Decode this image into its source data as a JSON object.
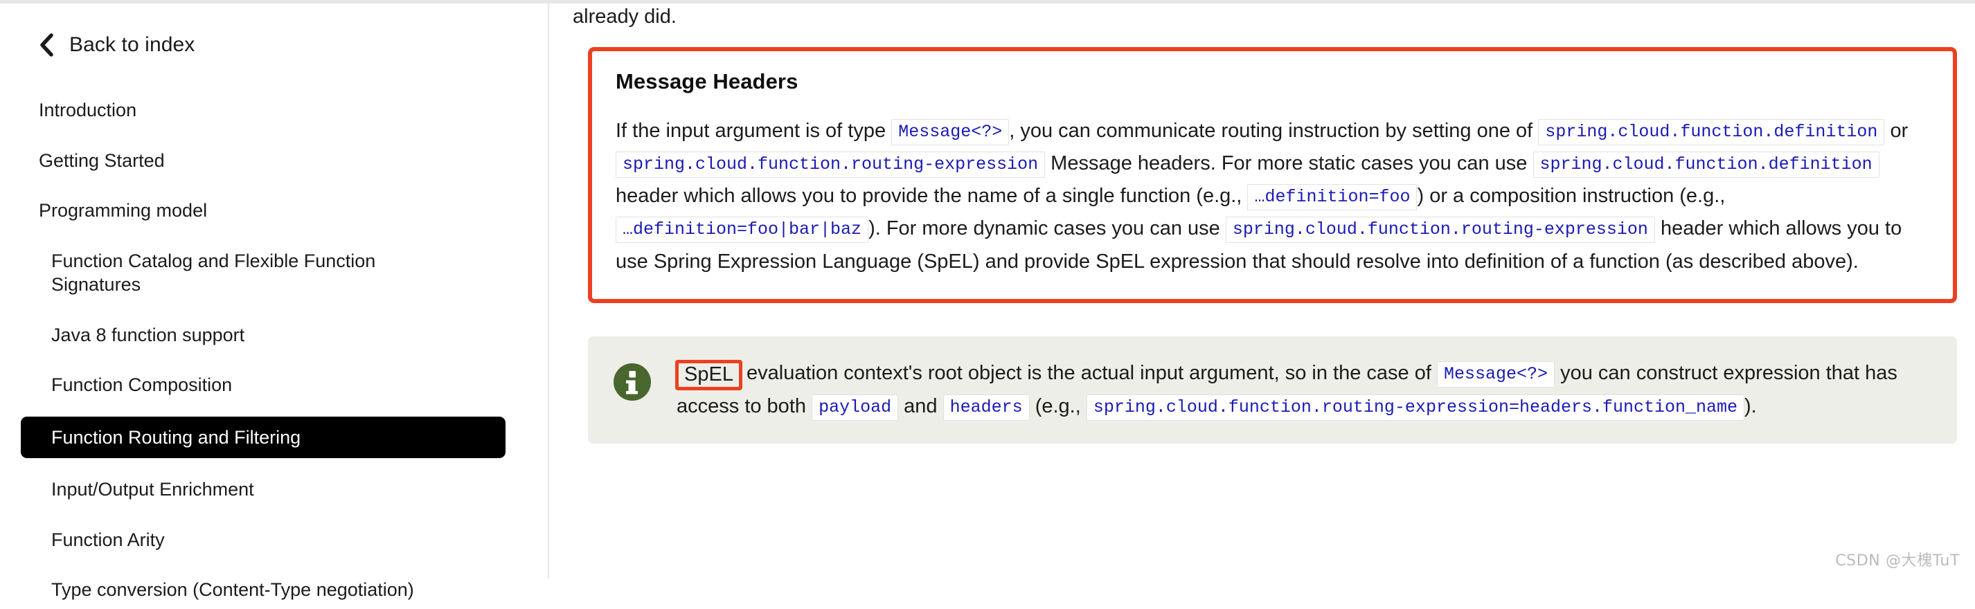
{
  "sidebar": {
    "back_label": "Back to index",
    "back_icon": "chevron-left-icon",
    "items": [
      {
        "label": "Introduction",
        "level": 1,
        "active": false
      },
      {
        "label": "Getting Started",
        "level": 1,
        "active": false
      },
      {
        "label": "Programming model",
        "level": 1,
        "active": false
      },
      {
        "label": "Function Catalog and Flexible Function Signatures",
        "level": 2,
        "active": false
      },
      {
        "label": "Java 8 function support",
        "level": 2,
        "active": false
      },
      {
        "label": "Function Composition",
        "level": 2,
        "active": false
      },
      {
        "label": "Function Routing and Filtering",
        "level": 2,
        "active": true
      },
      {
        "label": "Input/Output Enrichment",
        "level": 2,
        "active": false
      },
      {
        "label": "Function Arity",
        "level": 2,
        "active": false
      },
      {
        "label": "Type conversion (Content-Type negotiation)",
        "level": 2,
        "active": false
      }
    ]
  },
  "main": {
    "lead_text": "already did.",
    "callout": {
      "heading": "Message Headers",
      "border_color": "#ec4022",
      "paragraph": {
        "t1": "If the input argument is of type",
        "c1": "Message<?>",
        "t2": ", you can communicate routing instruction by setting one of",
        "c2": "spring.cloud.function.definition",
        "t3": "or",
        "c3": "spring.cloud.function.routing-expression",
        "t4": "Message headers. For more static cases you can use",
        "c4": "spring.cloud.function.definition",
        "t5": "header which allows you to provide the name of a single function (e.g.,",
        "c5": "…definition=foo",
        "t6": ") or a composition instruction (e.g.,",
        "c6": "…definition=foo|bar|baz",
        "t7": "). For more dynamic cases you can use",
        "c7": "spring.cloud.function.routing-expression",
        "t8": "header which allows you to use Spring Expression Language (SpEL) and provide SpEL expression that should resolve into definition of a function (as described above)."
      }
    },
    "note": {
      "icon": "info-icon",
      "icon_color": "#49662f",
      "background": "#eceee7",
      "highlight_word": "SpEL",
      "highlight_color": "#ec4022",
      "t1": "evaluation context's root object is the actual input argument, so in the case of",
      "c1": "Message<?>",
      "t2": "you can construct expression that has access to both",
      "c2": "payload",
      "t3": "and",
      "c3": "headers",
      "t4": "(e.g.,",
      "c4": "spring.cloud.function.routing-expression=headers.function_name",
      "t5": ")."
    }
  },
  "watermark": "CSDN @大槐TuT"
}
